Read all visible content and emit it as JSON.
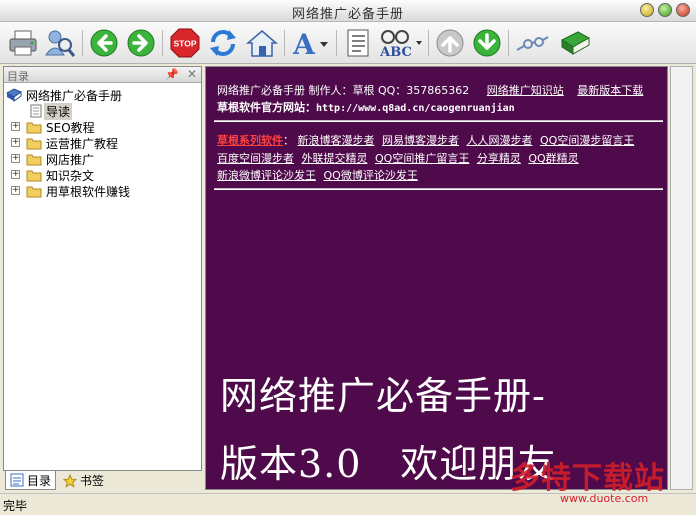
{
  "window": {
    "title": "网络推广必备手册"
  },
  "toolbar": {
    "buttons": [
      {
        "icon": "print-icon"
      },
      {
        "icon": "search-person-icon"
      },
      {
        "icon": "back-icon"
      },
      {
        "icon": "forward-icon"
      },
      {
        "icon": "stop-icon",
        "text": "STOP"
      },
      {
        "icon": "refresh-icon"
      },
      {
        "icon": "home-icon"
      },
      {
        "icon": "font-size-icon",
        "text": "A"
      },
      {
        "icon": "document-list-icon"
      },
      {
        "icon": "find-abc-icon",
        "text": "ABC"
      },
      {
        "icon": "scroll-up-icon"
      },
      {
        "icon": "scroll-down-icon"
      },
      {
        "icon": "options-icon"
      },
      {
        "icon": "book-icon"
      }
    ]
  },
  "leftpane": {
    "header": "目录",
    "tree": [
      {
        "label": "网络推广必备手册",
        "icon": "book-icon",
        "level": 0
      },
      {
        "label": "导读",
        "icon": "page-icon",
        "level": 1,
        "selected": true
      },
      {
        "label": "SEO教程",
        "icon": "folder-icon",
        "level": 1,
        "expander": "+"
      },
      {
        "label": "运营推广教程",
        "icon": "folder-icon",
        "level": 1,
        "expander": "+"
      },
      {
        "label": "网店推广",
        "icon": "folder-icon",
        "level": 1,
        "expander": "+"
      },
      {
        "label": "知识杂文",
        "icon": "folder-icon",
        "level": 1,
        "expander": "+"
      },
      {
        "label": "用草根软件赚钱",
        "icon": "folder-icon",
        "level": 1,
        "expander": "+"
      }
    ],
    "tabs": [
      {
        "label": "目录",
        "icon": "list-icon"
      },
      {
        "label": "书签",
        "icon": "star-icon"
      }
    ]
  },
  "content": {
    "header_line1": "网络推广必备手册 制作人：草根 QQ：357865362",
    "link_knowledge": "网络推广知识站",
    "link_latest": "最新版本下载",
    "website_label": "草根软件官方网站：",
    "website_url": "http://www.q8ad.cn/caogenruanjian",
    "series_label": "草根系列软件",
    "series_sep": "：",
    "software": [
      "新浪博客漫步者",
      "网易博客漫步者",
      "人人网漫步者",
      "QQ空间漫步留言王",
      "百度空间漫步者",
      "外联提交精灵",
      "QQ空间推广留言王",
      "分享精灵",
      "QQ群精灵",
      "新浪微博评论沙发王",
      "QQ微博评论沙发王"
    ],
    "big_title_line1": "网络推广必备手册-",
    "big_title_line2": "版本3.0　欢迎朋友"
  },
  "status": {
    "text": "完毕"
  },
  "watermark": {
    "text": "多特下载站",
    "sub": "www.duote.com"
  },
  "colors": {
    "content_bg": "#4e0a4a",
    "series_label": "#ff4040"
  }
}
